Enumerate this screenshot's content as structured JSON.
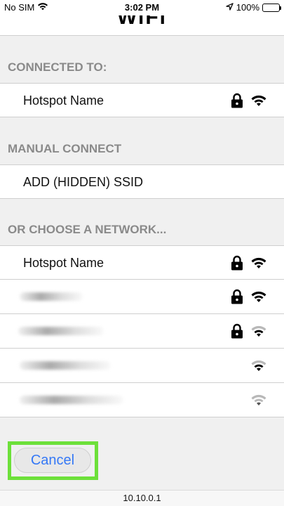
{
  "status_bar": {
    "carrier": "No SIM",
    "time": "3:02 PM",
    "battery": "100%",
    "battery_level": 1.0
  },
  "page": {
    "title": "WiFi"
  },
  "connected": {
    "header": "CONNECTED TO:",
    "network": {
      "name": "Hotspot Name",
      "secured": true,
      "signal": "strong"
    }
  },
  "manual": {
    "header": "MANUAL CONNECT",
    "add_label": "ADD (HIDDEN) SSID"
  },
  "choose": {
    "header": "OR CHOOSE A NETWORK...",
    "networks": [
      {
        "name": "Hotspot Name",
        "secured": true,
        "signal": "strong"
      },
      {
        "name": "",
        "secured": true,
        "signal": "strong",
        "obscured": true
      },
      {
        "name": "",
        "secured": true,
        "signal": "medium",
        "obscured": true
      },
      {
        "name": "",
        "secured": false,
        "signal": "medium",
        "obscured": true
      },
      {
        "name": "",
        "secured": false,
        "signal": "weak",
        "obscured": true
      }
    ]
  },
  "actions": {
    "cancel_label": "Cancel"
  },
  "footer": {
    "address": "10.10.0.1"
  },
  "colors": {
    "accent": "#3478f6",
    "highlight": "#6de03a",
    "section_header": "#8a8a8a",
    "battery": "#4cd964"
  }
}
